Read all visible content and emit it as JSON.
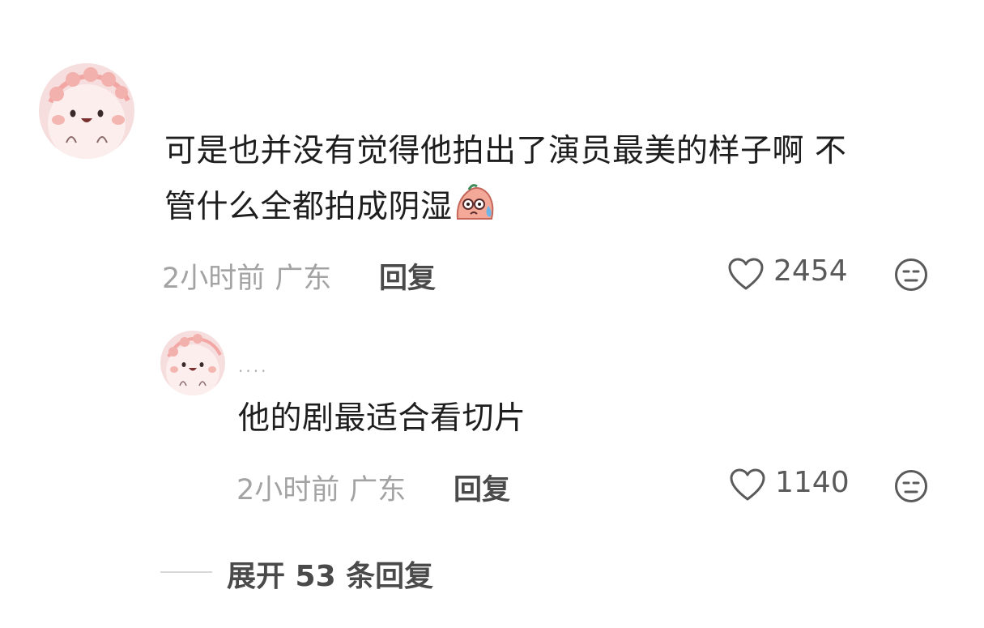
{
  "comments": [
    {
      "text_line1": "可是也并没有觉得他拍出了演员最美的样子啊 不",
      "text_line2": "管什么全都拍成阴湿",
      "emoji": "sweat-nervous-emoji",
      "time": "2小时前",
      "location": "广东",
      "reply_label": "回复",
      "likes": "2454",
      "avatar": "pink-cartoon-avatar"
    }
  ],
  "replies": [
    {
      "username": "....",
      "text": "他的剧最适合看切片",
      "time": "2小时前",
      "location": "广东",
      "reply_label": "回复",
      "likes": "1140",
      "avatar": "pink-cartoon-avatar"
    }
  ],
  "expand": {
    "label": "展开 53 条回复"
  },
  "icons": {
    "like": "heart-outline-icon",
    "dislike": "unamused-face-icon"
  },
  "colors": {
    "meta": "#a3a3a3",
    "avatar_bg": "#f7d9d9",
    "emoji_body": "#f4a998"
  }
}
